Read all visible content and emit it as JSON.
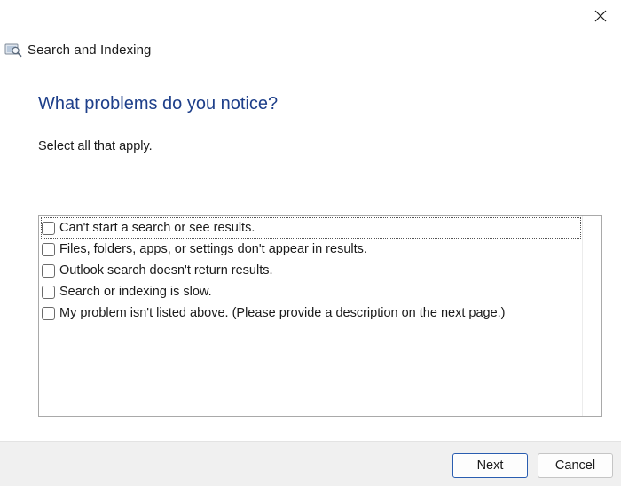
{
  "window": {
    "title": "Search and Indexing",
    "title_icon": "search-indexing-app-icon",
    "close_icon": "close-icon"
  },
  "page": {
    "heading": "What problems do you notice?",
    "instruction": "Select all that apply."
  },
  "options": [
    {
      "label": "Can't start a search or see results.",
      "checked": false,
      "focused": true
    },
    {
      "label": "Files, folders, apps, or settings don't appear in results.",
      "checked": false,
      "focused": false
    },
    {
      "label": "Outlook search doesn't return results.",
      "checked": false,
      "focused": false
    },
    {
      "label": "Search or indexing is slow.",
      "checked": false,
      "focused": false
    },
    {
      "label": "My problem isn't listed above. (Please provide a description on the next page.)",
      "checked": false,
      "focused": false
    }
  ],
  "footer": {
    "next_label": "Next",
    "cancel_label": "Cancel"
  },
  "colors": {
    "heading": "#1e3f8a",
    "footer_bg": "#f0f0f0",
    "primary_border": "#2a5db0"
  }
}
